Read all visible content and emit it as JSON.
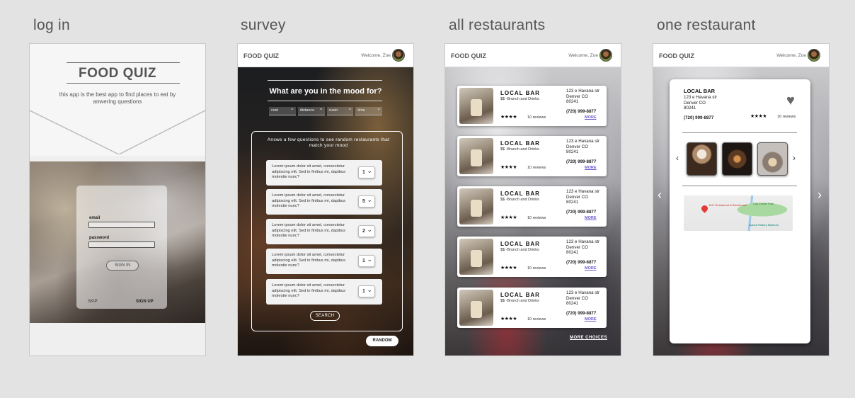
{
  "columns": {
    "login": "log in",
    "survey": "survey",
    "all": "all restaurants",
    "one": "one restaurant"
  },
  "login": {
    "brand": "FOOD QUIZ",
    "tagline": "this app is the best app to find places to eat by anwering questions",
    "email_label": "email",
    "password_label": "password",
    "signin": "SIGN IN",
    "skip": "SKIP",
    "signup": "SIGN UP"
  },
  "header": {
    "brand": "FOOD QUIZ",
    "welcome": "Welcome, Zoe"
  },
  "survey": {
    "question": "What are you in the mood for?",
    "filters": [
      "cost",
      "distance",
      "cusin",
      "time"
    ],
    "intro": "Answe a few questions to see random restaurants that match your mood",
    "questions": [
      {
        "text": "Lorem ipsum dolor sit amet, consectetur adipiscing elit. Sed in finibus mi, dapibus molestie nunc?",
        "value": "1"
      },
      {
        "text": "Lorem ipsum dolor sit amet, consectetur adipiscing elit. Sed in finibus mi, dapibus molestie nunc?",
        "value": "5"
      },
      {
        "text": "Lorem ipsum dolor sit amet, consectetur adipiscing elit. Sed in finibus mi, dapibus molestie nunc?",
        "value": "2"
      },
      {
        "text": "Lorem ipsum dolor sit amet, consectetur adipiscing elit. Sed in finibus mi, dapibus molestie nunc?",
        "value": "1"
      },
      {
        "text": "Lorem ipsum dolor sit amet, consectetur adipiscing elit. Sed in finibus mi, dapibus molestie nunc?",
        "value": "1"
      }
    ],
    "search": "SEARCH",
    "random": "RANDOM"
  },
  "restaurants": {
    "items": [
      {
        "name": "LOCAL BAR",
        "sub": "$$  -Brunch and Drinks",
        "addr1": "123 e Havana str",
        "addr2": "Denver CO",
        "addr3": "80241",
        "phone": "(720) 999-8877",
        "stars": "★★★★",
        "reviews": "10 reviews",
        "more": "MORE"
      },
      {
        "name": "LOCAL BAR",
        "sub": "$$  -Brunch and Drinks",
        "addr1": "123 e Havana str",
        "addr2": "Denver CO",
        "addr3": "80241",
        "phone": "(720) 999-8877",
        "stars": "★★★★",
        "reviews": "10 reviews",
        "more": "MORE"
      },
      {
        "name": "LOCAL BAR",
        "sub": "$$  -Brunch and Drinks",
        "addr1": "123 e Havana str",
        "addr2": "Denver CO",
        "addr3": "80241",
        "phone": "(720) 999-8877",
        "stars": "★★★★",
        "reviews": "10 reviews",
        "more": "MORE"
      },
      {
        "name": "LOCAL BAR",
        "sub": "$$  -Brunch and Drinks",
        "addr1": "123 e Havana str",
        "addr2": "Denver CO",
        "addr3": "80241",
        "phone": "(720) 999-8877",
        "stars": "★★★★",
        "reviews": "10 reviews",
        "more": "MORE"
      },
      {
        "name": "LOCAL BAR",
        "sub": "$$  -Brunch and Drinks",
        "addr1": "123 e Havana str",
        "addr2": "Denver CO",
        "addr3": "80241",
        "phone": "(720) 999-8877",
        "stars": "★★★★",
        "reviews": "10 reviews",
        "more": "MORE"
      }
    ],
    "more_choices": "MORE CHOICES"
  },
  "detail": {
    "name": "LOCAL BAR",
    "addr1": "123 e Havana str",
    "addr2": "Denver CO",
    "addr3": "80241",
    "phone": "(720) 999-8877",
    "stars": "★★★★",
    "reviews": "10 reviews",
    "favorite_icon": "heart-icon",
    "map_place": "BJ's Restaurant & Brewhouse",
    "map_park": "City Center Park",
    "map_museum": "Aurora History Museum"
  }
}
